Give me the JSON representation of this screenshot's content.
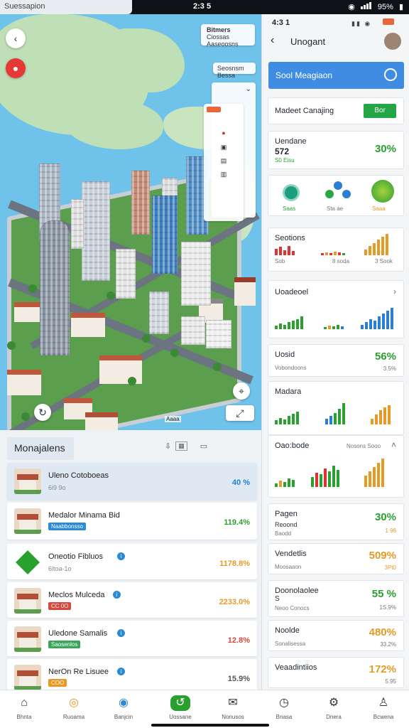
{
  "status_bar": {
    "time": "2:3 5",
    "notification": "Suessapion",
    "battery": "95%"
  },
  "map": {
    "top_card": {
      "title": "Bitmers",
      "lines": [
        "Ciossas",
        "Aaseoosns"
      ]
    },
    "filter_chip": "Seosnsm Bessa",
    "back": "‹",
    "zoom_label": "Aaaa"
  },
  "list": {
    "title": "Monajalens",
    "items": [
      {
        "name": "Uleno Cotoboeas",
        "sub": "6i9 9o",
        "value": "40 %",
        "color": "#1f7fd0",
        "tag": "",
        "tag_color": ""
      },
      {
        "name": "Medalor Minama Bid",
        "sub": "",
        "value": "119.4%",
        "color": "#2aa02f",
        "tag": "Naabbonsso",
        "tag_color": "#2a8ad8"
      },
      {
        "name": "Oneotio Fibluos",
        "sub": "6ltoa-1o",
        "value": "1178.8%",
        "color": "#e69a25",
        "tag": "",
        "tag_color": ""
      },
      {
        "name": "Meclos Mulceda",
        "sub": "",
        "value": "2233.0%",
        "color": "#e69a25",
        "tag": "CC 0O",
        "tag_color": "#d9463a"
      },
      {
        "name": "Uledone Samalis",
        "sub": "",
        "value": "12.8%",
        "color": "#d9463a",
        "tag": "Saosenlos",
        "tag_color": "#3aa55a"
      },
      {
        "name": "NerOn Re Lisuee",
        "sub": "",
        "value": "15.9%",
        "color": "#555",
        "tag": "COO",
        "tag_color": "#e69a25"
      }
    ]
  },
  "right": {
    "header": {
      "time": "4:3 1",
      "title": "Unogant",
      "back": "‹"
    },
    "search": {
      "label": "Sool Meagiaon"
    },
    "market": {
      "label": "Madeet Canajing",
      "button": "Bor"
    },
    "card1": {
      "title": "Uendane",
      "value": "572",
      "sub": "S0 Eisu",
      "pct": "30%"
    },
    "icons_row": [
      "Saas",
      "Sta ae",
      "Saaa"
    ],
    "card2": {
      "title": "Seotions",
      "labels": [
        "Sob",
        "8 soda",
        "3 Sook"
      ]
    },
    "card3": {
      "title": "Uoadeoel"
    },
    "card4": {
      "title": "Uosid",
      "sub": "Vobondoons",
      "pct": "56%",
      "small": "3.5%"
    },
    "card5": {
      "title": "Madara"
    },
    "card6": {
      "title": "Oao:bode",
      "mid": "Nosons Sooo"
    },
    "card7": {
      "title": "Pagen",
      "sub": "Reoond",
      "sub2": "Baodd",
      "pct": "30%",
      "small": "1 96"
    },
    "card8": {
      "title": "Vendetlis",
      "sub": "Moosaaon",
      "pct": "509%",
      "small": "3Pt0"
    },
    "card9": {
      "title": "Doonolaolee",
      "title2": "S",
      "sub": "Neoo Conocs",
      "pct": "55 %",
      "small": "1S.9%"
    },
    "card10": {
      "title": "Noolde",
      "sub": "Sonalisessa",
      "pct": "480%",
      "small": "33.2%"
    },
    "card11": {
      "title": "Veaadintiios",
      "pct": "172%",
      "small": "5.95"
    }
  },
  "nav": {
    "items": [
      "Bhnta",
      "Ruoama",
      "Banjcin",
      "Uossane",
      "Nonusos",
      "Bnasa",
      "Dnera",
      "Bcwena"
    ]
  },
  "colors": {
    "green": "#2aa02f",
    "orange": "#e69a25",
    "blue": "#2a7fd4",
    "accent_blue": "#3e8de3"
  }
}
